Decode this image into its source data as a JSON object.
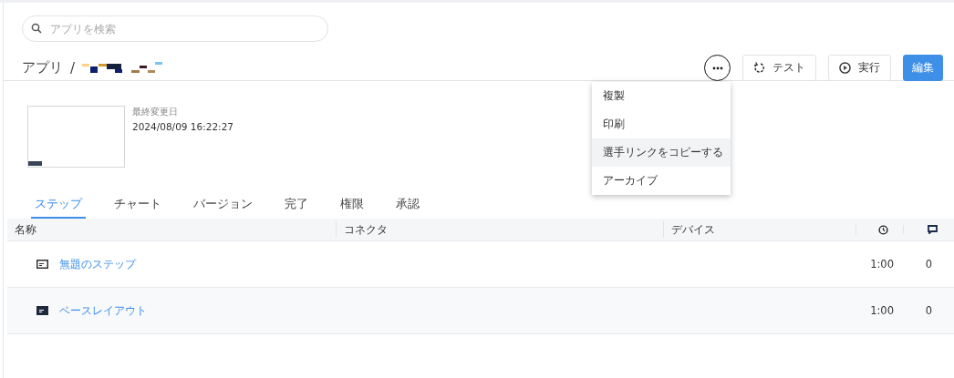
{
  "search": {
    "placeholder": "アプリを検索"
  },
  "breadcrumb": {
    "root": "アプリ",
    "separator": "/"
  },
  "actions": [
    {
      "label": "テスト",
      "kind": "test"
    },
    {
      "label": "実行",
      "kind": "run"
    },
    {
      "label": "編集",
      "kind": "primary"
    }
  ],
  "more_menu": {
    "expanded": true,
    "items": [
      {
        "label": "複製",
        "selected": false
      },
      {
        "label": "印刷",
        "selected": false
      },
      {
        "label": "選手リンクをコピーする",
        "selected": true
      },
      {
        "label": "アーカイブ",
        "selected": false
      }
    ]
  },
  "meta": {
    "label": "最終変更日",
    "value": "2024/08/09 16:22:27"
  },
  "tabs": [
    {
      "label": "ステップ",
      "selected": true
    },
    {
      "label": "チャート",
      "selected": false
    },
    {
      "label": "バージョン",
      "selected": false
    },
    {
      "label": "完了",
      "selected": false
    },
    {
      "label": "権限",
      "selected": false
    },
    {
      "label": "承認",
      "selected": false
    }
  ],
  "table": {
    "columns": [
      "名称",
      "コネクタ",
      "デバイス"
    ],
    "rows": [
      {
        "name": "無題のステップ",
        "kind": "outline",
        "duration": "1:00",
        "comments": "0"
      },
      {
        "name": "ベースレイアウト",
        "kind": "filled",
        "duration": "1:00",
        "comments": "0"
      }
    ]
  }
}
